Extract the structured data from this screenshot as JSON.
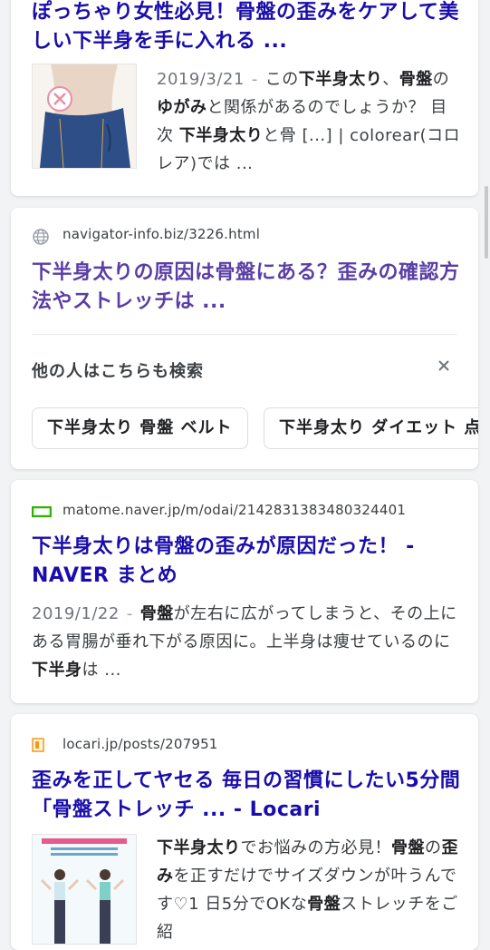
{
  "results": [
    {
      "title": "ぽっちゃり女性必見！骨盤の歪みをケアして美しい下半身を手に入れる ...",
      "date": "2019/3/21",
      "snippet_parts": [
        {
          "t": "この"
        },
        {
          "b": "下半身太り"
        },
        {
          "t": "、"
        },
        {
          "b": "骨盤"
        },
        {
          "t": "の"
        },
        {
          "b": "ゆがみ"
        },
        {
          "t": "と関係があるのでしょうか？ 目次 "
        },
        {
          "b": "下半身太り"
        },
        {
          "t": "と骨 [...] | colorear(コロレア)では ..."
        }
      ]
    },
    {
      "url": "navigator-info.biz/3226.html",
      "title": "下半身太りの原因は骨盤にある？歪みの確認方法やストレッチは ..."
    },
    {
      "url": "matome.naver.jp/m/odai/2142831383480324401",
      "title": "下半身太りは骨盤の歪みが原因だった！ - NAVER まとめ",
      "date": "2019/1/22",
      "snippet_parts": [
        {
          "b": "骨盤"
        },
        {
          "t": "が左右に広がってしまうと、その上にある胃腸が垂れ下がる原因に。上半身は痩せているのに"
        },
        {
          "b": "下半身"
        },
        {
          "t": "は ..."
        }
      ]
    },
    {
      "url": "locari.jp/posts/207951",
      "title": "歪みを正してヤセる 毎日の習慣にしたい5分間「骨盤ストレッチ ... - Locari",
      "snippet_parts": [
        {
          "b": "下半身太り"
        },
        {
          "t": "でお悩みの方必見！"
        },
        {
          "b": "骨盤"
        },
        {
          "t": "の"
        },
        {
          "b": "歪み"
        },
        {
          "t": "を正すだけでサイズダウンが叶うんです♡1 日5分でOKな"
        },
        {
          "b": "骨盤"
        },
        {
          "t": "ストレッチをご紹"
        }
      ]
    }
  ],
  "related": {
    "heading": "他の人はこちらも検索",
    "chips": [
      "下半身太り 骨盤 ベルト",
      "下半身太り ダイエット 点"
    ]
  },
  "colors": {
    "link": "#1a0dab",
    "visited": "#5a3ea5",
    "naver": "#2db400",
    "locari": "#f29a1d"
  }
}
